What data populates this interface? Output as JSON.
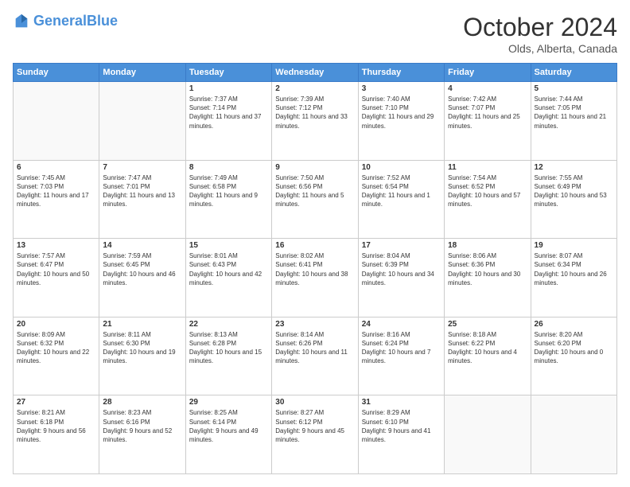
{
  "header": {
    "logo_general": "General",
    "logo_blue": "Blue",
    "month_title": "October 2024",
    "location": "Olds, Alberta, Canada"
  },
  "weekdays": [
    "Sunday",
    "Monday",
    "Tuesday",
    "Wednesday",
    "Thursday",
    "Friday",
    "Saturday"
  ],
  "weeks": [
    [
      {
        "day": "",
        "sunrise": "",
        "sunset": "",
        "daylight": ""
      },
      {
        "day": "",
        "sunrise": "",
        "sunset": "",
        "daylight": ""
      },
      {
        "day": "1",
        "sunrise": "Sunrise: 7:37 AM",
        "sunset": "Sunset: 7:14 PM",
        "daylight": "Daylight: 11 hours and 37 minutes."
      },
      {
        "day": "2",
        "sunrise": "Sunrise: 7:39 AM",
        "sunset": "Sunset: 7:12 PM",
        "daylight": "Daylight: 11 hours and 33 minutes."
      },
      {
        "day": "3",
        "sunrise": "Sunrise: 7:40 AM",
        "sunset": "Sunset: 7:10 PM",
        "daylight": "Daylight: 11 hours and 29 minutes."
      },
      {
        "day": "4",
        "sunrise": "Sunrise: 7:42 AM",
        "sunset": "Sunset: 7:07 PM",
        "daylight": "Daylight: 11 hours and 25 minutes."
      },
      {
        "day": "5",
        "sunrise": "Sunrise: 7:44 AM",
        "sunset": "Sunset: 7:05 PM",
        "daylight": "Daylight: 11 hours and 21 minutes."
      }
    ],
    [
      {
        "day": "6",
        "sunrise": "Sunrise: 7:45 AM",
        "sunset": "Sunset: 7:03 PM",
        "daylight": "Daylight: 11 hours and 17 minutes."
      },
      {
        "day": "7",
        "sunrise": "Sunrise: 7:47 AM",
        "sunset": "Sunset: 7:01 PM",
        "daylight": "Daylight: 11 hours and 13 minutes."
      },
      {
        "day": "8",
        "sunrise": "Sunrise: 7:49 AM",
        "sunset": "Sunset: 6:58 PM",
        "daylight": "Daylight: 11 hours and 9 minutes."
      },
      {
        "day": "9",
        "sunrise": "Sunrise: 7:50 AM",
        "sunset": "Sunset: 6:56 PM",
        "daylight": "Daylight: 11 hours and 5 minutes."
      },
      {
        "day": "10",
        "sunrise": "Sunrise: 7:52 AM",
        "sunset": "Sunset: 6:54 PM",
        "daylight": "Daylight: 11 hours and 1 minute."
      },
      {
        "day": "11",
        "sunrise": "Sunrise: 7:54 AM",
        "sunset": "Sunset: 6:52 PM",
        "daylight": "Daylight: 10 hours and 57 minutes."
      },
      {
        "day": "12",
        "sunrise": "Sunrise: 7:55 AM",
        "sunset": "Sunset: 6:49 PM",
        "daylight": "Daylight: 10 hours and 53 minutes."
      }
    ],
    [
      {
        "day": "13",
        "sunrise": "Sunrise: 7:57 AM",
        "sunset": "Sunset: 6:47 PM",
        "daylight": "Daylight: 10 hours and 50 minutes."
      },
      {
        "day": "14",
        "sunrise": "Sunrise: 7:59 AM",
        "sunset": "Sunset: 6:45 PM",
        "daylight": "Daylight: 10 hours and 46 minutes."
      },
      {
        "day": "15",
        "sunrise": "Sunrise: 8:01 AM",
        "sunset": "Sunset: 6:43 PM",
        "daylight": "Daylight: 10 hours and 42 minutes."
      },
      {
        "day": "16",
        "sunrise": "Sunrise: 8:02 AM",
        "sunset": "Sunset: 6:41 PM",
        "daylight": "Daylight: 10 hours and 38 minutes."
      },
      {
        "day": "17",
        "sunrise": "Sunrise: 8:04 AM",
        "sunset": "Sunset: 6:39 PM",
        "daylight": "Daylight: 10 hours and 34 minutes."
      },
      {
        "day": "18",
        "sunrise": "Sunrise: 8:06 AM",
        "sunset": "Sunset: 6:36 PM",
        "daylight": "Daylight: 10 hours and 30 minutes."
      },
      {
        "day": "19",
        "sunrise": "Sunrise: 8:07 AM",
        "sunset": "Sunset: 6:34 PM",
        "daylight": "Daylight: 10 hours and 26 minutes."
      }
    ],
    [
      {
        "day": "20",
        "sunrise": "Sunrise: 8:09 AM",
        "sunset": "Sunset: 6:32 PM",
        "daylight": "Daylight: 10 hours and 22 minutes."
      },
      {
        "day": "21",
        "sunrise": "Sunrise: 8:11 AM",
        "sunset": "Sunset: 6:30 PM",
        "daylight": "Daylight: 10 hours and 19 minutes."
      },
      {
        "day": "22",
        "sunrise": "Sunrise: 8:13 AM",
        "sunset": "Sunset: 6:28 PM",
        "daylight": "Daylight: 10 hours and 15 minutes."
      },
      {
        "day": "23",
        "sunrise": "Sunrise: 8:14 AM",
        "sunset": "Sunset: 6:26 PM",
        "daylight": "Daylight: 10 hours and 11 minutes."
      },
      {
        "day": "24",
        "sunrise": "Sunrise: 8:16 AM",
        "sunset": "Sunset: 6:24 PM",
        "daylight": "Daylight: 10 hours and 7 minutes."
      },
      {
        "day": "25",
        "sunrise": "Sunrise: 8:18 AM",
        "sunset": "Sunset: 6:22 PM",
        "daylight": "Daylight: 10 hours and 4 minutes."
      },
      {
        "day": "26",
        "sunrise": "Sunrise: 8:20 AM",
        "sunset": "Sunset: 6:20 PM",
        "daylight": "Daylight: 10 hours and 0 minutes."
      }
    ],
    [
      {
        "day": "27",
        "sunrise": "Sunrise: 8:21 AM",
        "sunset": "Sunset: 6:18 PM",
        "daylight": "Daylight: 9 hours and 56 minutes."
      },
      {
        "day": "28",
        "sunrise": "Sunrise: 8:23 AM",
        "sunset": "Sunset: 6:16 PM",
        "daylight": "Daylight: 9 hours and 52 minutes."
      },
      {
        "day": "29",
        "sunrise": "Sunrise: 8:25 AM",
        "sunset": "Sunset: 6:14 PM",
        "daylight": "Daylight: 9 hours and 49 minutes."
      },
      {
        "day": "30",
        "sunrise": "Sunrise: 8:27 AM",
        "sunset": "Sunset: 6:12 PM",
        "daylight": "Daylight: 9 hours and 45 minutes."
      },
      {
        "day": "31",
        "sunrise": "Sunrise: 8:29 AM",
        "sunset": "Sunset: 6:10 PM",
        "daylight": "Daylight: 9 hours and 41 minutes."
      },
      {
        "day": "",
        "sunrise": "",
        "sunset": "",
        "daylight": ""
      },
      {
        "day": "",
        "sunrise": "",
        "sunset": "",
        "daylight": ""
      }
    ]
  ]
}
